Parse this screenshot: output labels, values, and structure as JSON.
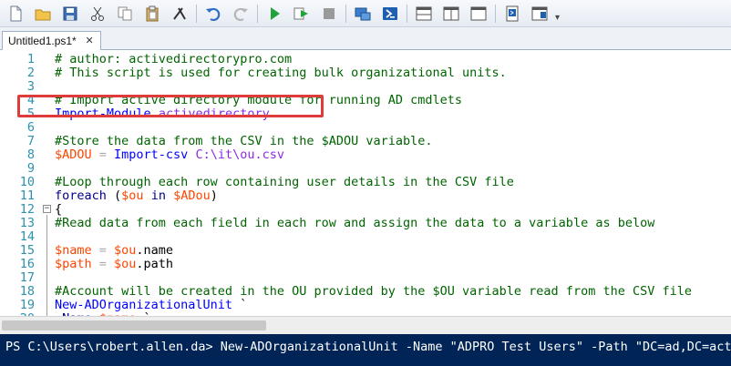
{
  "toolbar": {
    "icons": [
      "new-file-icon",
      "open-folder-icon",
      "save-icon",
      "cut-icon",
      "copy-icon",
      "paste-icon",
      "clear-icon",
      "undo-icon",
      "redo-icon",
      "run-icon",
      "run-selection-icon",
      "stop-icon",
      "remote-session-icon",
      "powershell-icon",
      "layout-top-icon",
      "layout-right-icon",
      "layout-max-icon",
      "command-add-on-icon",
      "show-script-pane-icon"
    ],
    "overflow": "▾"
  },
  "tab": {
    "title": "Untitled1.ps1*",
    "close": "✕"
  },
  "editor": {
    "lines": [
      {
        "n": "1",
        "segments": [
          {
            "t": "# author: activedirectorypro.com",
            "c": "comment"
          }
        ]
      },
      {
        "n": "2",
        "segments": [
          {
            "t": "# This script is used for creating bulk organizational units.",
            "c": "comment"
          }
        ]
      },
      {
        "n": "3",
        "segments": []
      },
      {
        "n": "4",
        "segments": [
          {
            "t": "# Import active directory module for running AD cmdlets",
            "c": "comment"
          }
        ]
      },
      {
        "n": "5",
        "segments": [
          {
            "t": "Import-Module",
            "c": "cmdlet"
          },
          {
            "t": " ",
            "c": "plain"
          },
          {
            "t": "activedirectory",
            "c": "str"
          }
        ]
      },
      {
        "n": "6",
        "segments": []
      },
      {
        "n": "7",
        "segments": [
          {
            "t": "#Store the data from the CSV in the $ADOU variable.",
            "c": "comment"
          }
        ]
      },
      {
        "n": "8",
        "segments": [
          {
            "t": "$ADOU",
            "c": "var"
          },
          {
            "t": " = ",
            "c": "op"
          },
          {
            "t": "Import-csv",
            "c": "cmdlet"
          },
          {
            "t": " ",
            "c": "plain"
          },
          {
            "t": "C:\\it\\ou.csv",
            "c": "str"
          }
        ]
      },
      {
        "n": "9",
        "segments": []
      },
      {
        "n": "10",
        "segments": [
          {
            "t": "#Loop through each row containing user details in the CSV file",
            "c": "comment"
          }
        ]
      },
      {
        "n": "11",
        "segments": [
          {
            "t": "foreach",
            "c": "kw"
          },
          {
            "t": " (",
            "c": "plain"
          },
          {
            "t": "$ou",
            "c": "var"
          },
          {
            "t": " in ",
            "c": "kw"
          },
          {
            "t": "$ADou",
            "c": "var"
          },
          {
            "t": ")",
            "c": "plain"
          }
        ]
      },
      {
        "n": "12",
        "segments": [
          {
            "t": "{",
            "c": "plain"
          }
        ],
        "fold": true
      },
      {
        "n": "13",
        "segments": [
          {
            "t": "#Read data from each field in each row and assign the data to a variable as below",
            "c": "comment"
          }
        ]
      },
      {
        "n": "14",
        "segments": []
      },
      {
        "n": "15",
        "segments": [
          {
            "t": "$name",
            "c": "var"
          },
          {
            "t": " = ",
            "c": "op"
          },
          {
            "t": "$ou",
            "c": "var"
          },
          {
            "t": ".name",
            "c": "plain"
          }
        ]
      },
      {
        "n": "16",
        "segments": [
          {
            "t": "$path",
            "c": "var"
          },
          {
            "t": " = ",
            "c": "op"
          },
          {
            "t": "$ou",
            "c": "var"
          },
          {
            "t": ".path",
            "c": "plain"
          }
        ]
      },
      {
        "n": "17",
        "segments": []
      },
      {
        "n": "18",
        "segments": [
          {
            "t": "#Account will be created in the OU provided by the $OU variable read from the CSV file",
            "c": "comment"
          }
        ]
      },
      {
        "n": "19",
        "segments": [
          {
            "t": "New-ADOrganizationalUnit",
            "c": "cmdlet"
          },
          {
            "t": " `",
            "c": "plain"
          }
        ]
      },
      {
        "n": "20",
        "segments": [
          {
            "t": "-Name",
            "c": "kw"
          },
          {
            "t": " ",
            "c": "plain"
          },
          {
            "t": "$name",
            "c": "var"
          },
          {
            "t": " `",
            "c": "plain"
          }
        ]
      }
    ]
  },
  "console": {
    "text": "PS C:\\Users\\robert.allen.da> New-ADOrganizationalUnit -Name \"ADPRO Test Users\" -Path \"DC=ad,DC=activedirectorypro,DC=com\""
  }
}
